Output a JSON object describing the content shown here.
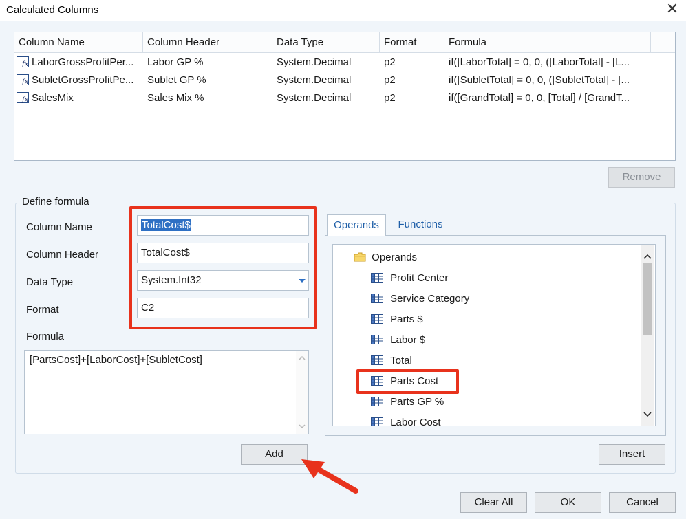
{
  "window": {
    "title": "Calculated Columns",
    "close_glyph": "✕"
  },
  "grid": {
    "columns": [
      "Column Name",
      "Column Header",
      "Data Type",
      "Format",
      "Formula"
    ],
    "rows": [
      {
        "name": "LaborGrossProfitPer...",
        "header": "Labor GP %",
        "type": "System.Decimal",
        "format": "p2",
        "formula": "if([LaborTotal] = 0, 0, ([LaborTotal] - [L..."
      },
      {
        "name": "SubletGrossProfitPe...",
        "header": "Sublet GP %",
        "type": "System.Decimal",
        "format": "p2",
        "formula": "if([SubletTotal] = 0, 0, ([SubletTotal] - [..."
      },
      {
        "name": "SalesMix",
        "header": "Sales Mix %",
        "type": "System.Decimal",
        "format": "p2",
        "formula": "if([GrandTotal] = 0, 0, [Total] / [GrandT..."
      }
    ]
  },
  "buttons": {
    "remove": "Remove",
    "add": "Add",
    "insert": "Insert",
    "clear_all": "Clear All",
    "ok": "OK",
    "cancel": "Cancel"
  },
  "define": {
    "group_label": "Define formula",
    "column_name_label": "Column Name",
    "column_name_value": "TotalCost$",
    "column_header_label": "Column Header",
    "column_header_value": "TotalCost$",
    "data_type_label": "Data Type",
    "data_type_value": "System.Int32",
    "format_label": "Format",
    "format_value": "C2",
    "formula_label": "Formula",
    "formula_value": "[PartsCost]+[LaborCost]+[SubletCost]"
  },
  "tabs": [
    "Operands",
    "Functions"
  ],
  "tree": {
    "root": "Operands",
    "items": [
      "Profit Center",
      "Service Category",
      "Parts $",
      "Labor $",
      "Total",
      "Parts Cost",
      "Parts GP %",
      "Labor Cost"
    ]
  },
  "colors": {
    "highlight": "#e8321c",
    "selection": "#2e70c4",
    "link": "#1f5fa8"
  }
}
